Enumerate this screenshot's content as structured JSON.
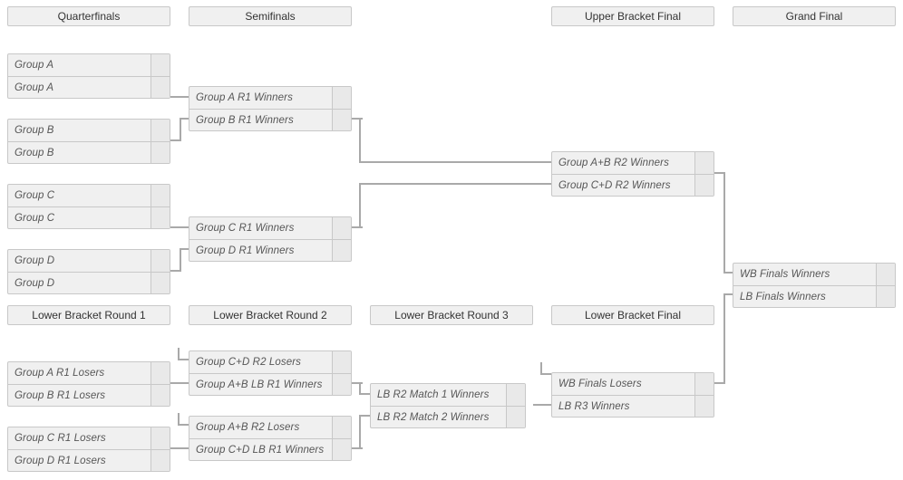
{
  "page": {
    "title": "Double Elimination Tournament Bracket",
    "colors": {
      "box_fill": "#f0f0f0",
      "box_border": "#c8c8c8",
      "score_fill": "#e9e9e9",
      "participant_text": "#565656",
      "header_text": "#333333",
      "connector": "#a9a9a9",
      "background": "#ffffff"
    }
  },
  "upper_bracket": {
    "rounds": [
      {
        "id": "quarterfinals",
        "label": "Quarterfinals",
        "matches": [
          {
            "id": "qf1",
            "slots": [
              {
                "name": "Group A",
                "score": ""
              },
              {
                "name": "Group A",
                "score": ""
              }
            ]
          },
          {
            "id": "qf2",
            "slots": [
              {
                "name": "Group B",
                "score": ""
              },
              {
                "name": "Group B",
                "score": ""
              }
            ]
          },
          {
            "id": "qf3",
            "slots": [
              {
                "name": "Group C",
                "score": ""
              },
              {
                "name": "Group C",
                "score": ""
              }
            ]
          },
          {
            "id": "qf4",
            "slots": [
              {
                "name": "Group D",
                "score": ""
              },
              {
                "name": "Group D",
                "score": ""
              }
            ]
          }
        ]
      },
      {
        "id": "semifinals",
        "label": "Semifinals",
        "matches": [
          {
            "id": "sf1",
            "slots": [
              {
                "name": "Group A R1 Winners",
                "score": ""
              },
              {
                "name": "Group B R1 Winners",
                "score": ""
              }
            ]
          },
          {
            "id": "sf2",
            "slots": [
              {
                "name": "Group C R1 Winners",
                "score": ""
              },
              {
                "name": "Group D R1 Winners",
                "score": ""
              }
            ]
          }
        ]
      },
      {
        "id": "upper-bracket-final",
        "label": "Upper Bracket Final",
        "matches": [
          {
            "id": "ubf1",
            "slots": [
              {
                "name": "Group A+B R2 Winners",
                "score": ""
              },
              {
                "name": "Group C+D R2 Winners",
                "score": ""
              }
            ]
          }
        ]
      },
      {
        "id": "grand-final",
        "label": "Grand Final",
        "matches": [
          {
            "id": "gf1",
            "slots": [
              {
                "name": "WB Finals Winners",
                "score": ""
              },
              {
                "name": "LB Finals Winners",
                "score": ""
              }
            ]
          }
        ]
      }
    ]
  },
  "lower_bracket": {
    "rounds": [
      {
        "id": "lower-bracket-round-1",
        "label": "Lower Bracket Round 1",
        "matches": [
          {
            "id": "lb1m1",
            "slots": [
              {
                "name": "Group A R1 Losers",
                "score": ""
              },
              {
                "name": "Group B R1 Losers",
                "score": ""
              }
            ]
          },
          {
            "id": "lb1m2",
            "slots": [
              {
                "name": "Group C R1 Losers",
                "score": ""
              },
              {
                "name": "Group D R1 Losers",
                "score": ""
              }
            ]
          }
        ]
      },
      {
        "id": "lower-bracket-round-2",
        "label": "Lower Bracket Round 2",
        "matches": [
          {
            "id": "lb2m1",
            "slots": [
              {
                "name": "Group C+D R2 Losers",
                "score": ""
              },
              {
                "name": "Group A+B LB R1 Winners",
                "score": ""
              }
            ]
          },
          {
            "id": "lb2m2",
            "slots": [
              {
                "name": "Group A+B R2 Losers",
                "score": ""
              },
              {
                "name": "Group C+D LB R1 Winners",
                "score": ""
              }
            ]
          }
        ]
      },
      {
        "id": "lower-bracket-round-3",
        "label": "Lower Bracket Round 3",
        "matches": [
          {
            "id": "lb3m1",
            "slots": [
              {
                "name": "LB R2 Match 1 Winners",
                "score": ""
              },
              {
                "name": "LB R2 Match 2 Winners",
                "score": ""
              }
            ]
          }
        ]
      },
      {
        "id": "lower-bracket-final",
        "label": "Lower Bracket Final",
        "matches": [
          {
            "id": "lbf1",
            "slots": [
              {
                "name": "WB Finals Losers",
                "score": ""
              },
              {
                "name": "LB R3 Winners",
                "score": ""
              }
            ]
          }
        ]
      }
    ]
  }
}
